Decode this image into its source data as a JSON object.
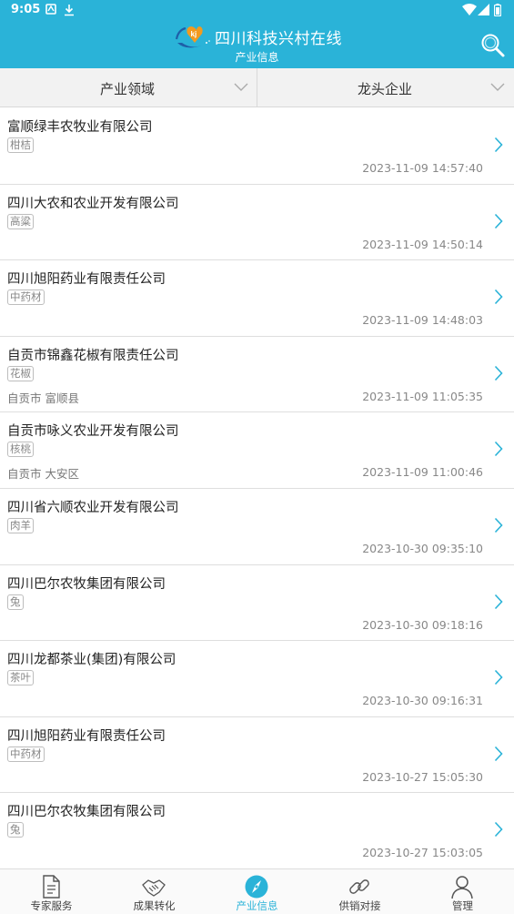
{
  "status_bar": {
    "time": "9:05"
  },
  "header": {
    "title": "四川科技兴村在线",
    "subtitle": "产业信息",
    "logo_letter": "kj"
  },
  "filters": [
    {
      "label": "产业领域"
    },
    {
      "label": "龙头企业"
    }
  ],
  "items": [
    {
      "name": "富顺绿丰农牧业有限公司",
      "tag": "柑桔",
      "location": "",
      "date": "2023-11-09 14:57:40"
    },
    {
      "name": "四川大农和农业开发有限公司",
      "tag": "高粱",
      "location": "",
      "date": "2023-11-09 14:50:14"
    },
    {
      "name": "四川旭阳药业有限责任公司",
      "tag": "中药材",
      "location": "",
      "date": "2023-11-09 14:48:03"
    },
    {
      "name": "自贡市锦鑫花椒有限责任公司",
      "tag": "花椒",
      "location": "自贡市  富顺县",
      "date": "2023-11-09 11:05:35"
    },
    {
      "name": "自贡市咏义农业开发有限公司",
      "tag": "核桃",
      "location": "自贡市  大安区",
      "date": "2023-11-09 11:00:46"
    },
    {
      "name": "四川省六顺农业开发有限公司",
      "tag": "肉羊",
      "location": "",
      "date": "2023-10-30 09:35:10"
    },
    {
      "name": "四川巴尔农牧集团有限公司",
      "tag": "兔",
      "location": "",
      "date": "2023-10-30 09:18:16"
    },
    {
      "name": "四川龙都茶业(集团)有限公司",
      "tag": "茶叶",
      "location": "",
      "date": "2023-10-30 09:16:31"
    },
    {
      "name": "四川旭阳药业有限责任公司",
      "tag": "中药材",
      "location": "",
      "date": "2023-10-27 15:05:30"
    },
    {
      "name": "四川巴尔农牧集团有限公司",
      "tag": "兔",
      "location": "",
      "date": "2023-10-27 15:03:05"
    }
  ],
  "tabs": [
    {
      "label": "专家服务",
      "icon": "document-icon"
    },
    {
      "label": "成果转化",
      "icon": "handshake-icon"
    },
    {
      "label": "产业信息",
      "icon": "compass-icon",
      "active": true
    },
    {
      "label": "供销对接",
      "icon": "link-icon"
    },
    {
      "label": "管理",
      "icon": "user-icon"
    }
  ],
  "colors": {
    "primary": "#2ab3d8",
    "divider": "#dedede",
    "tag_border": "#bdbdbd"
  }
}
